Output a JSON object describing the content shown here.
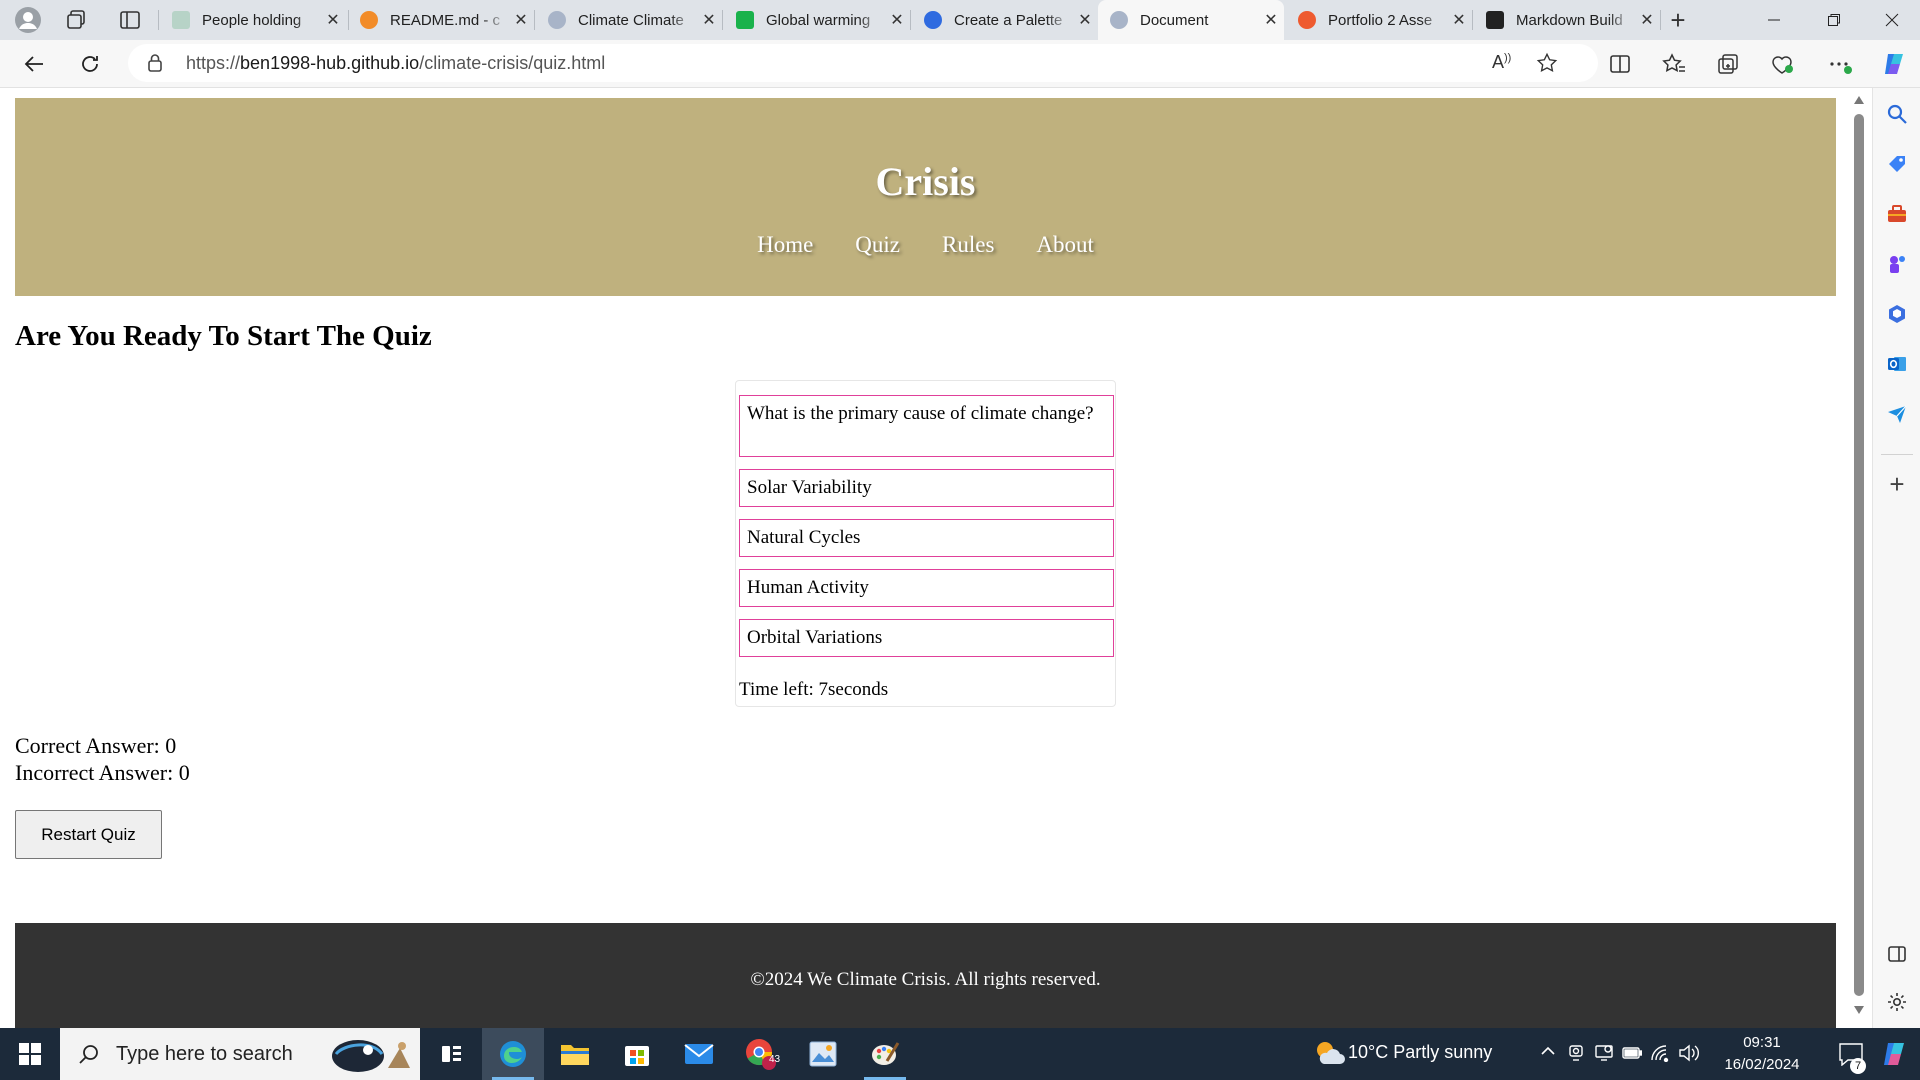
{
  "browser": {
    "tabs": [
      {
        "title": "People holding",
        "favicon_color": "#b7d3c7"
      },
      {
        "title": "README.md - c",
        "favicon_color": "#f28c28"
      },
      {
        "title": "Climate Climate",
        "favicon_color": "#a8b4c8"
      },
      {
        "title": "Global warming",
        "favicon_color": "#19b24b"
      },
      {
        "title": "Create a Palette",
        "favicon_color": "#2f6be0"
      },
      {
        "title": "Document",
        "favicon_color": "#a8b4c8",
        "active": true
      },
      {
        "title": "Portfolio 2 Asse",
        "favicon_color": "#ee5a2f"
      },
      {
        "title": "Markdown Build",
        "favicon_color": "#222222"
      }
    ],
    "url_prefix": "https://",
    "url_host": "ben1998-hub.github.io",
    "url_path": "/climate-crisis/quiz.html"
  },
  "site": {
    "title": "Crisis",
    "nav": [
      "Home",
      "Quiz",
      "Rules",
      "About"
    ],
    "heading": "Are You Ready To Start The Quiz",
    "quiz": {
      "question": "What is the primary cause of climate change?",
      "options": [
        "Solar Variability",
        "Natural Cycles",
        "Human Activity",
        "Orbital Variations"
      ],
      "timer_label": "Time left: 7seconds"
    },
    "score": {
      "correct": "Correct Answer: 0",
      "incorrect": "Incorrect Answer: 0"
    },
    "restart_label": "Restart Quiz",
    "footer": "©2024 We Climate Crisis. All rights reserved.",
    "colors": {
      "header": "#bfb17e",
      "option_border": "#e0409a",
      "footer": "#333333"
    }
  },
  "taskbar": {
    "search_placeholder": "Type here to search",
    "weather": "10°C  Partly sunny",
    "time": "09:31",
    "date": "16/02/2024",
    "chrome_badge": "43",
    "notification_count": "7"
  }
}
